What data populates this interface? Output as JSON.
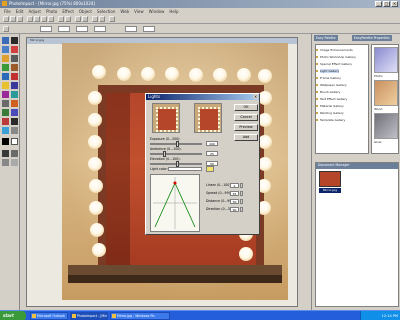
{
  "app": {
    "title": "PhotoImpact - [Mirror.jpg (75%) 800x1024]"
  },
  "menu": [
    "File",
    "Edit",
    "Adjust",
    "Photo",
    "Effect",
    "Object",
    "Selection",
    "Web",
    "View",
    "Window",
    "Help"
  ],
  "canvas": {
    "title": "Mirror.jpg"
  },
  "dialog": {
    "title": "Lights",
    "buttons": {
      "ok": "OK",
      "cancel": "Cancel",
      "preview": "Preview",
      "add": "Add"
    },
    "sliders": [
      {
        "label": "Exposure (0...200):",
        "value": "100",
        "fraction": 0.5
      },
      {
        "label": "Ambience (0...100):",
        "value": "25",
        "fraction": 0.25
      },
      {
        "label": "Elevation (0...100):",
        "value": "50",
        "fraction": 0.5
      }
    ],
    "light_color_label": "Light color:",
    "light_color": "#f5e26a",
    "fields": [
      {
        "label": "Linear (0...100):",
        "value": "2"
      },
      {
        "label": "Spread (0...99):",
        "value": "45"
      },
      {
        "label": "Distance (0...99):",
        "value": "30"
      },
      {
        "label": "Direction (0...360):",
        "value": "90"
      }
    ]
  },
  "panel": {
    "tabs": [
      "Easy Palette",
      "EasyPalette Properties"
    ],
    "gallery_items": [
      "Image Enhancements",
      "Photo Workshop Gallery",
      "Special Effect Gallery",
      "Light Gallery",
      "Frame Gallery",
      "Wallpaper Gallery",
      "Brush Gallery",
      "Text Effect Gallery",
      "Material Gallery",
      "Painting Gallery",
      "Template Gallery"
    ],
    "thumbs": [
      "Photo",
      "Wood",
      "Glow"
    ],
    "doc_manager_title": "Document Manager",
    "doc_thumb_label": "Mirror.jpg"
  },
  "taskbar": {
    "start": "start",
    "tasks": [
      "Microsoft Outlook",
      "PhotoImpact - [Mirror]",
      "Mirror.jpg - Windows Pic"
    ],
    "clock": "12:14 PM"
  },
  "colors": {
    "mirror": "#b5462a",
    "wall": "#c9a87a",
    "titlebar": "#0a246a"
  }
}
